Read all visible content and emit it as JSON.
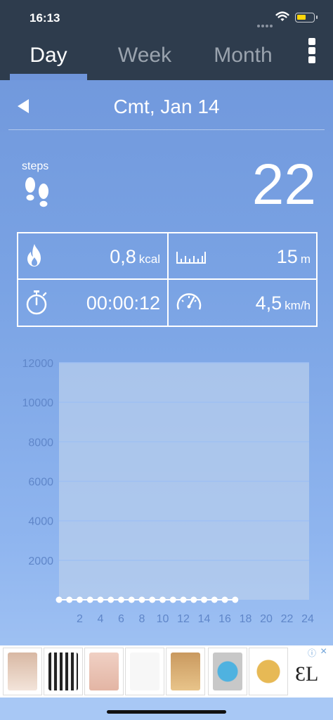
{
  "status_bar": {
    "time": "16:13"
  },
  "tabs": [
    {
      "label": "Day",
      "active": true
    },
    {
      "label": "Week",
      "active": false
    },
    {
      "label": "Month",
      "active": false
    }
  ],
  "date_nav": {
    "title": "Cmt, Jan 14"
  },
  "steps": {
    "label": "steps",
    "value": "22"
  },
  "stats": {
    "calories": {
      "value": "0,8",
      "unit": "kcal",
      "icon": "flame-icon"
    },
    "distance": {
      "value": "15",
      "unit": "m",
      "icon": "ruler-icon"
    },
    "duration": {
      "value": "00:00:12",
      "icon": "stopwatch-icon"
    },
    "speed": {
      "value": "4,5",
      "unit": "km/h",
      "icon": "speedometer-icon"
    }
  },
  "chart_data": {
    "type": "line",
    "y_ticks": [
      "12000",
      "10000",
      "8000",
      "6000",
      "4000",
      "2000"
    ],
    "x_ticks": [
      "2",
      "4",
      "6",
      "8",
      "10",
      "12",
      "14",
      "16",
      "18",
      "20",
      "22",
      "24"
    ],
    "ylim": [
      0,
      12000
    ],
    "xlim": [
      0,
      24
    ],
    "grid": true,
    "x": [
      0,
      1,
      2,
      3,
      4,
      5,
      6,
      7,
      8,
      9,
      10,
      11,
      12,
      13,
      14,
      15,
      16,
      17
    ],
    "values": [
      0,
      0,
      0,
      0,
      0,
      0,
      0,
      0,
      0,
      0,
      0,
      0,
      0,
      0,
      0,
      0,
      0,
      0
    ],
    "colors": {
      "grid": "#9fc0f3",
      "plot_bg": "#b7cdec",
      "axis_text": "#5f86c9",
      "points": "#ffffff"
    }
  },
  "ad": {
    "logo": "ƐL"
  }
}
